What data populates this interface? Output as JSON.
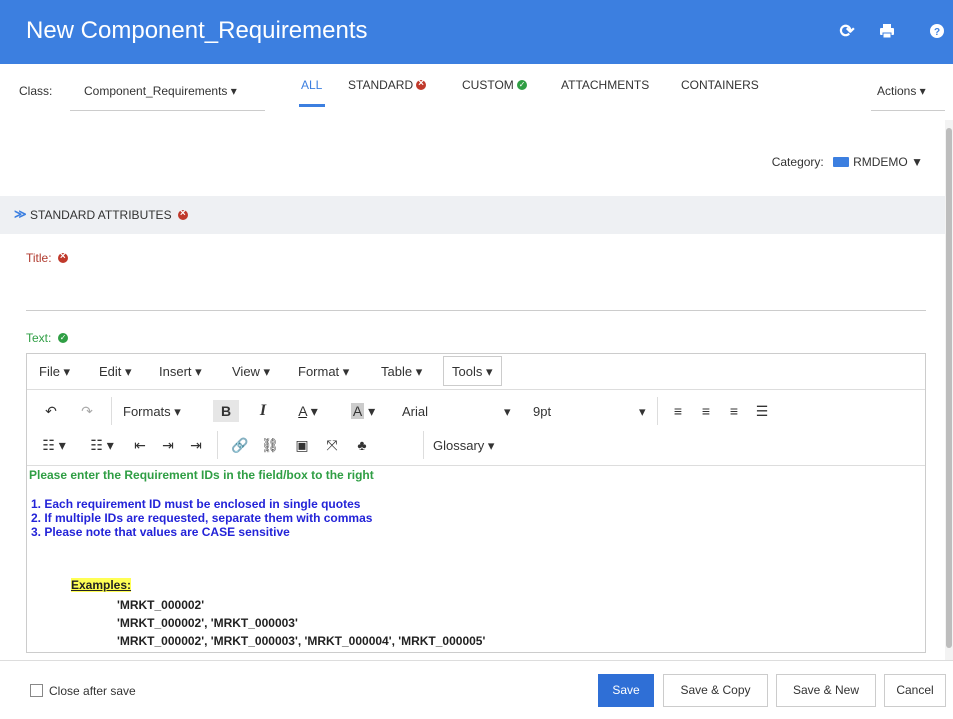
{
  "header": {
    "title": "New Component_Requirements",
    "icons": [
      "refresh-icon",
      "print-icon",
      "help-icon"
    ]
  },
  "tabs": {
    "class_label": "Class:",
    "class_value": "Component_Requirements ▾",
    "items": [
      {
        "label": "ALL",
        "state": "active"
      },
      {
        "label": "STANDARD",
        "state": "error"
      },
      {
        "label": "CUSTOM",
        "state": "ok"
      },
      {
        "label": "ATTACHMENTS",
        "state": "none"
      },
      {
        "label": "CONTAINERS",
        "state": "none"
      }
    ],
    "actions_label": "Actions ▾"
  },
  "category": {
    "label": "Category:",
    "value": "RMDEMO"
  },
  "section": {
    "label": "STANDARD ATTRIBUTES"
  },
  "fields": {
    "title_label": "Title:",
    "text_label": "Text:"
  },
  "editor": {
    "menus": [
      "File ▾",
      "Edit ▾",
      "Insert ▾",
      "View ▾",
      "Format ▾",
      "Table ▾",
      "Tools ▾"
    ],
    "toolbar": {
      "formats": "Formats ▾",
      "font": "Arial",
      "font_size": "9pt",
      "glossary": "Glossary ▾"
    },
    "content": {
      "intro": "Please enter the Requirement IDs in the field/box to the right",
      "list": [
        "1. Each requirement ID must be enclosed in single quotes",
        "2. If multiple IDs are requested, separate them with commas",
        "3. Please note that values are CASE sensitive"
      ],
      "examples_label": "Examples:",
      "examples": [
        "'MRKT_000002'",
        "'MRKT_000002', 'MRKT_000003'",
        "'MRKT_000002', 'MRKT_000003', 'MRKT_000004', 'MRKT_000005'"
      ]
    }
  },
  "footer": {
    "close_after_save": "Close after save",
    "save": "Save",
    "save_copy": "Save & Copy",
    "save_new": "Save & New",
    "cancel": "Cancel"
  },
  "colors": {
    "brand": "#3c7fe0",
    "error": "#c0392b",
    "ok": "#2f9e44",
    "list_text": "#2323d8"
  }
}
